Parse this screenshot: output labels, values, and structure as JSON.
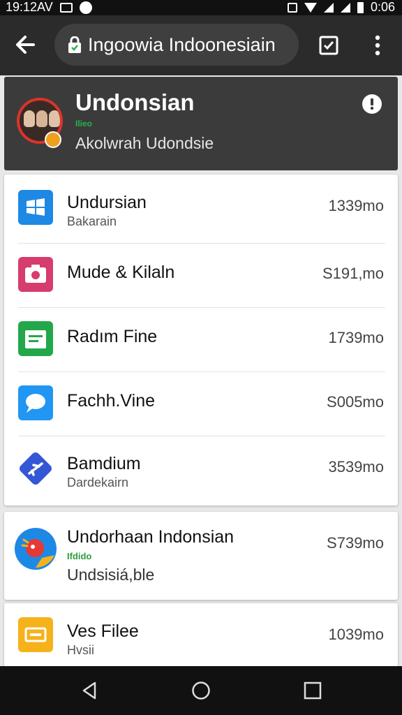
{
  "status_bar": {
    "time_left": "19:12AV",
    "time_right": "0:06"
  },
  "toolbar": {
    "url": "Ingoowia Indoonesiain"
  },
  "header": {
    "title": "Undonsian",
    "tag": "Ilieo",
    "subtitle": "Akolwrah Udondsie"
  },
  "card1": {
    "items": [
      {
        "icon": "windows-app-icon",
        "color": "#1e88e5",
        "title": "Undursian",
        "subtitle": "Bakarain",
        "value": "1339mo"
      },
      {
        "icon": "camera-app-icon",
        "color": "#d63c6e",
        "title": "Mude & Kilaln",
        "subtitle": "",
        "value": "S191,mo"
      },
      {
        "icon": "document-app-icon",
        "color": "#22a84a",
        "title": "Radım Fine",
        "subtitle": "",
        "value": "1739mo"
      },
      {
        "icon": "chat-app-icon",
        "color": "#2196f3",
        "title": "Fachh.Vine",
        "subtitle": "",
        "value": "S005mo"
      },
      {
        "icon": "plane-app-icon",
        "color": "#3457d5",
        "title": "Bamdium",
        "subtitle": "Dardekairn",
        "value": "3539mo"
      }
    ]
  },
  "card2": {
    "item": {
      "icon": "bird-app-icon",
      "color": "#1e88e5",
      "title": "Undorhaan Indonsian",
      "tag": "Ifdido",
      "subtitle": "Undsisiá,ble",
      "value": "S739mo"
    }
  },
  "card3": {
    "item": {
      "icon": "files-app-icon",
      "color": "#f6b21b",
      "title": "Ves Filee",
      "subtitle": "Hvsii",
      "value": "1039mo"
    }
  }
}
